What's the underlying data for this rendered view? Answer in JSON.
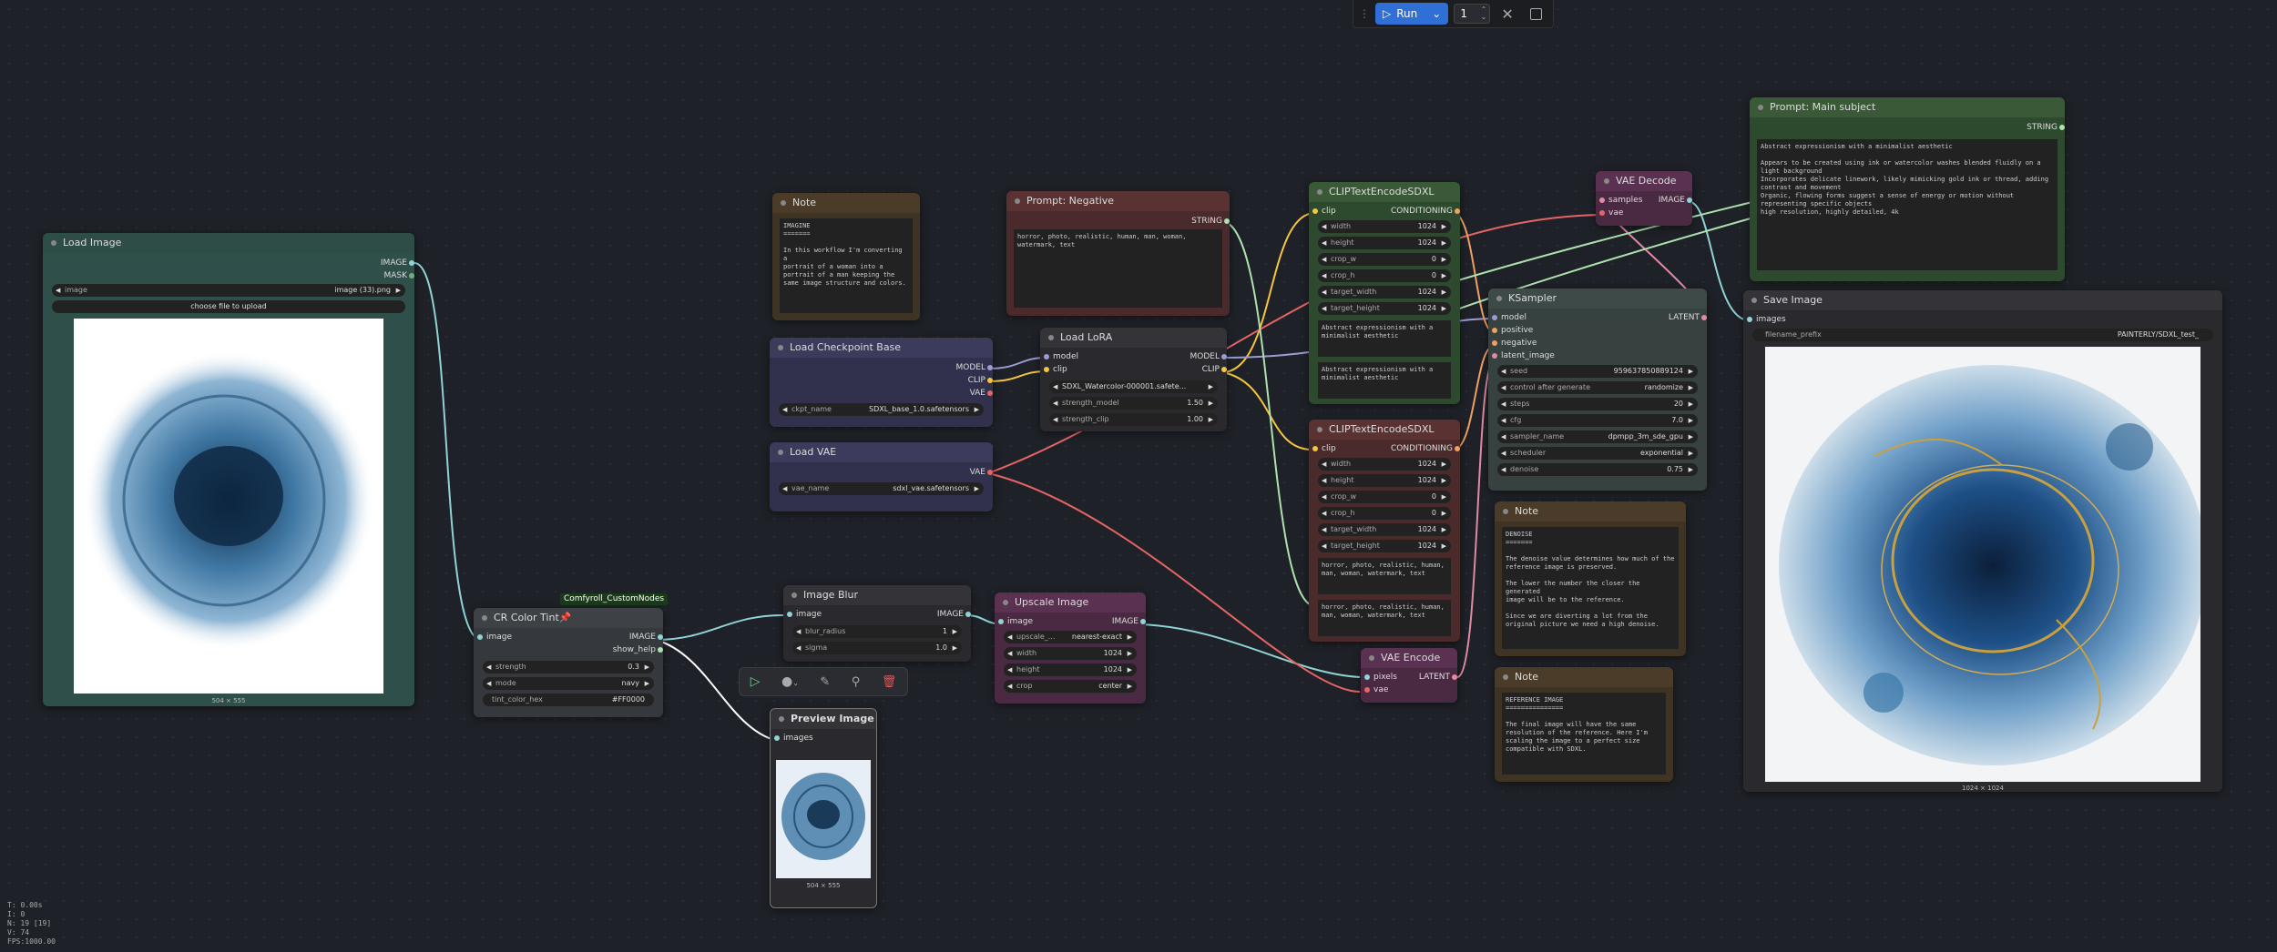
{
  "toolbar": {
    "run_label": "Run",
    "queue_count": "1"
  },
  "stats": {
    "lines": [
      "T: 0.00s",
      "I: 0",
      "N: 19 [19]",
      "V: 74",
      "FPS:1000.00"
    ]
  },
  "load_image": {
    "title": "Load Image",
    "outputs": [
      "IMAGE",
      "MASK"
    ],
    "image_label": "image",
    "image_value": "image (33).png",
    "upload_label": "choose file to upload",
    "size": "504 × 555"
  },
  "color_tint": {
    "badge": "Comfyroll_CustomNodes",
    "title": "CR Color Tint📌",
    "input": "image",
    "outputs": [
      "IMAGE",
      "show_help"
    ],
    "widgets": [
      {
        "label": "strength",
        "value": "0.3"
      },
      {
        "label": "mode",
        "value": "navy"
      },
      {
        "label": "tint_color_hex",
        "value": "#FF0000"
      }
    ]
  },
  "note1": {
    "title": "Note",
    "text": "IMAGINE\n=======\n\nIn this workflow I'm converting a\nportrait of a woman into a\nportrait of a man keeping the\nsame image structure and colors."
  },
  "checkpoint": {
    "title": "Load Checkpoint Base",
    "outputs": [
      "MODEL",
      "CLIP",
      "VAE"
    ],
    "widget_label": "ckpt_name",
    "widget_value": "SDXL_base_1.0.safetensors"
  },
  "vae_loader": {
    "title": "Load VAE",
    "output": "VAE",
    "widget_label": "vae_name",
    "widget_value": "sdxl_vae.safetensors"
  },
  "blur": {
    "title": "Image Blur",
    "input": "image",
    "output": "IMAGE",
    "widgets": [
      {
        "label": "blur_radius",
        "value": "1"
      },
      {
        "label": "sigma",
        "value": "1.0"
      }
    ]
  },
  "preview": {
    "title": "Preview Image",
    "input": "images",
    "size": "504 × 555"
  },
  "prompt_neg": {
    "title": "Prompt: Negative",
    "output": "STRING",
    "text": "horror, photo, realistic, human, man, woman,\nwatermark, text"
  },
  "lora": {
    "title": "Load LoRA",
    "inputs": [
      "model",
      "clip"
    ],
    "outputs": [
      "MODEL",
      "CLIP"
    ],
    "widgets": [
      {
        "label": "",
        "value": "SDXL_Watercolor-000001.safete..."
      },
      {
        "label": "strength_model",
        "value": "1.50"
      },
      {
        "label": "strength_clip",
        "value": "1.00"
      }
    ]
  },
  "upscale": {
    "title": "Upscale Image",
    "input": "image",
    "output": "IMAGE",
    "widgets": [
      {
        "label": "upscale_...",
        "value": "nearest-exact"
      },
      {
        "label": "width",
        "value": "1024"
      },
      {
        "label": "height",
        "value": "1024"
      },
      {
        "label": "crop",
        "value": "center"
      }
    ]
  },
  "clip1": {
    "title": "CLIPTextEncodeSDXL",
    "input": "clip",
    "output": "CONDITIONING",
    "widgets": [
      {
        "label": "width",
        "value": "1024"
      },
      {
        "label": "height",
        "value": "1024"
      },
      {
        "label": "crop_w",
        "value": "0"
      },
      {
        "label": "crop_h",
        "value": "0"
      },
      {
        "label": "target_width",
        "value": "1024"
      },
      {
        "label": "target_height",
        "value": "1024"
      }
    ],
    "text_g": "Abstract expressionism with a\nminimalist aesthetic",
    "text_l": "Abstract expressionism with a\nminimalist aesthetic"
  },
  "clip2": {
    "title": "CLIPTextEncodeSDXL",
    "input": "clip",
    "output": "CONDITIONING",
    "widgets": [
      {
        "label": "width",
        "value": "1024"
      },
      {
        "label": "height",
        "value": "1024"
      },
      {
        "label": "crop_w",
        "value": "0"
      },
      {
        "label": "crop_h",
        "value": "0"
      },
      {
        "label": "target_width",
        "value": "1024"
      },
      {
        "label": "target_height",
        "value": "1024"
      }
    ],
    "text_g": "horror, photo, realistic, human,\nman, woman, watermark, text",
    "text_l": "horror, photo, realistic, human,\nman, woman, watermark, text"
  },
  "vae_encode": {
    "title": "VAE Encode",
    "inputs": [
      "pixels",
      "vae"
    ],
    "output": "LATENT"
  },
  "vae_decode": {
    "title": "VAE Decode",
    "inputs": [
      "samples",
      "vae"
    ],
    "output": "IMAGE"
  },
  "ksampler": {
    "title": "KSampler",
    "inputs": [
      "model",
      "positive",
      "negative",
      "latent_image"
    ],
    "output": "LATENT",
    "widgets": [
      {
        "label": "seed",
        "value": "959637850889124"
      },
      {
        "label": "control after generate",
        "value": "randomize"
      },
      {
        "label": "steps",
        "value": "20"
      },
      {
        "label": "cfg",
        "value": "7.0"
      },
      {
        "label": "sampler_name",
        "value": "dpmpp_3m_sde_gpu"
      },
      {
        "label": "scheduler",
        "value": "exponential"
      },
      {
        "label": "denoise",
        "value": "0.75"
      }
    ]
  },
  "note2": {
    "title": "Note",
    "text": "DENOISE\n=======\n\nThe denoise value determines how much of the\nreference image is preserved.\n\nThe lower the number the closer the generated\nimage will be to the reference.\n\nSince we are diverting a lot from the\noriginal picture we need a high denoise."
  },
  "note3": {
    "title": "Note",
    "text": "REFERENCE IMAGE\n===============\n\nThe final image will have the same\nresolution of the reference. Here I'm\nscaling the image to a perfect size\ncompatible with SDXL."
  },
  "prompt_main": {
    "title": "Prompt: Main subject",
    "output": "STRING",
    "text": "Abstract expressionism with a minimalist aesthetic\n\nAppears to be created using ink or watercolor washes blended fluidly on a\nlight background\nIncorporates delicate linework, likely mimicking gold ink or thread, adding\ncontrast and movement\nOrganic, flowing forms suggest a sense of energy or motion without\nrepresenting specific objects\nhigh resolution, highly detailed, 4k"
  },
  "save_image": {
    "title": "Save Image",
    "input": "images",
    "widget_label": "filename_prefix",
    "widget_value": "PAINTERLY/SDXL_test_",
    "size": "1024 × 1024"
  },
  "colors": {
    "run": "#2f6fd6",
    "clip_slot": "#f5c542",
    "model_slot": "#9b9bd6",
    "vae_slot": "#e56565",
    "image_slot": "#8fd3d6",
    "cond_slot": "#f0a060",
    "latent_slot": "#e08aa6"
  }
}
